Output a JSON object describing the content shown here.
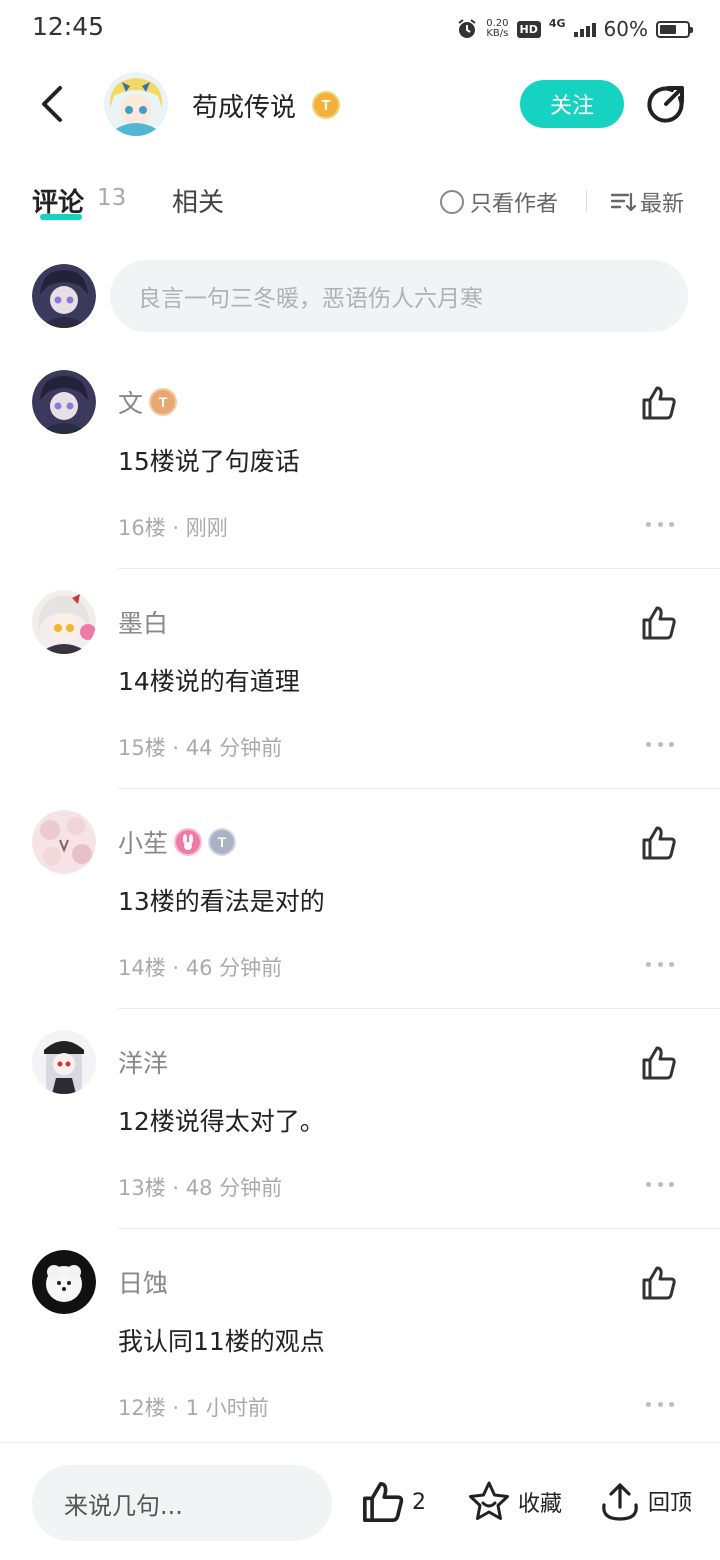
{
  "status_bar": {
    "time": "12:45",
    "net_speed_value": "0.20",
    "net_speed_unit": "KB/s",
    "hd_label": "HD",
    "network_type": "4G",
    "battery_text": "60%",
    "battery_level": 0.6
  },
  "header": {
    "author_name": "苟成传说",
    "author_badge": "T",
    "follow_label": "关注"
  },
  "tabs": {
    "comments_label": "评论",
    "comments_count": "13",
    "related_label": "相关",
    "author_only_label": "只看作者",
    "sort_label": "最新"
  },
  "comment_input": {
    "placeholder": "良言一句三冬暖，恶语伤人六月寒"
  },
  "comments": [
    {
      "name": "文",
      "badges": [
        "T"
      ],
      "text": "15楼说了句废话",
      "floor": "16楼",
      "time": "刚刚"
    },
    {
      "name": "墨白",
      "badges": [],
      "text": "14楼说的有道理",
      "floor": "15楼",
      "time": "44 分钟前"
    },
    {
      "name": "小苼",
      "badges": [
        "",
        "T"
      ],
      "text": "13楼的看法是对的",
      "floor": "14楼",
      "time": "46 分钟前"
    },
    {
      "name": "洋洋",
      "badges": [],
      "text": "12楼说得太对了。",
      "floor": "13楼",
      "time": "48 分钟前"
    },
    {
      "name": "日蚀",
      "badges": [],
      "text": "我认同11楼的观点",
      "floor": "12楼",
      "time": "1 小时前"
    }
  ],
  "bottom_bar": {
    "input_placeholder": "来说几句...",
    "like_count": "2",
    "favorite_label": "收藏",
    "top_label": "回顶"
  },
  "colors": {
    "accent": "#15d3c0",
    "badge_gold": "#f2b23a",
    "badge_bronze": "#e8a873",
    "badge_silver": "#a9b3c4",
    "badge_pink": "#f07aa6"
  }
}
